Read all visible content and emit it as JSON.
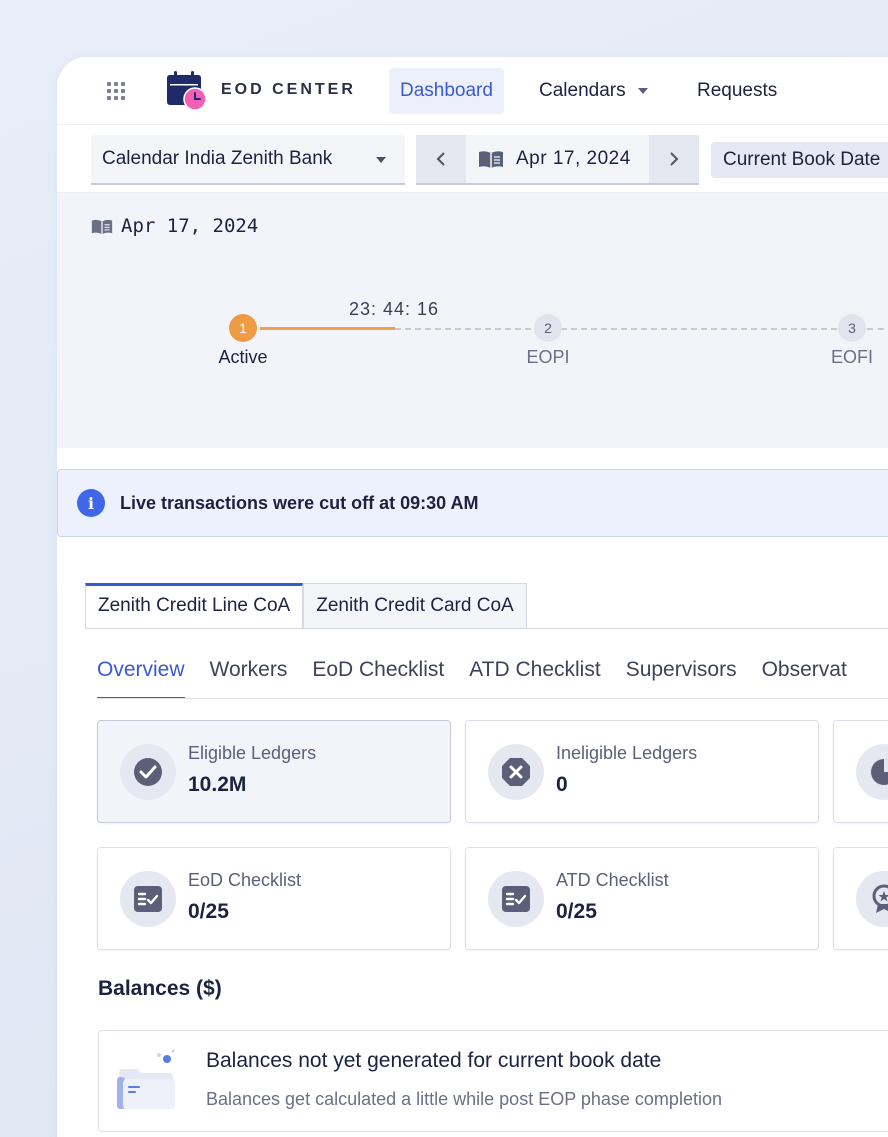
{
  "nav": {
    "brand": "EOD CENTER",
    "items": [
      {
        "label": "Dashboard",
        "active": true
      },
      {
        "label": "Calendars",
        "dropdown": true
      },
      {
        "label": "Requests"
      }
    ]
  },
  "toolbar": {
    "calendar_select": "Calendar India Zenith Bank",
    "date": "Apr 17, 2024",
    "chip": "Current Book Date"
  },
  "timeline": {
    "date": "Apr 17, 2024",
    "timer": "23: 44: 16",
    "steps": [
      {
        "num": "1",
        "label": "Active",
        "state": "active"
      },
      {
        "num": "2",
        "label": "EOPI",
        "state": "pending"
      },
      {
        "num": "3",
        "label": "EOFI",
        "state": "pending"
      }
    ]
  },
  "alert": {
    "message": "Live transactions were cut off at 09:30 AM"
  },
  "coa_tabs": [
    "Zenith Credit Line CoA",
    "Zenith Credit Card CoA"
  ],
  "sub_tabs": [
    "Overview",
    "Workers",
    "EoD Checklist",
    "ATD Checklist",
    "Supervisors",
    "Observat"
  ],
  "metrics": [
    {
      "label": "Eligible Ledgers",
      "value": "10.2M",
      "icon": "check-circle-icon"
    },
    {
      "label": "Ineligible Ledgers",
      "value": "0",
      "icon": "x-octagon-icon"
    },
    {
      "label": "EoD Checklist",
      "value": "0/25",
      "icon": "checklist-icon"
    },
    {
      "label": "ATD Checklist",
      "value": "0/25",
      "icon": "checklist-icon"
    }
  ],
  "balances": {
    "title": "Balances ($)",
    "empty_title": "Balances not yet generated for current book date",
    "empty_subtitle": "Balances get calculated a little while post EOP phase completion"
  },
  "colors": {
    "accent": "#3a5bd0",
    "active_step": "#ee9b43",
    "info": "#3f67e8"
  }
}
